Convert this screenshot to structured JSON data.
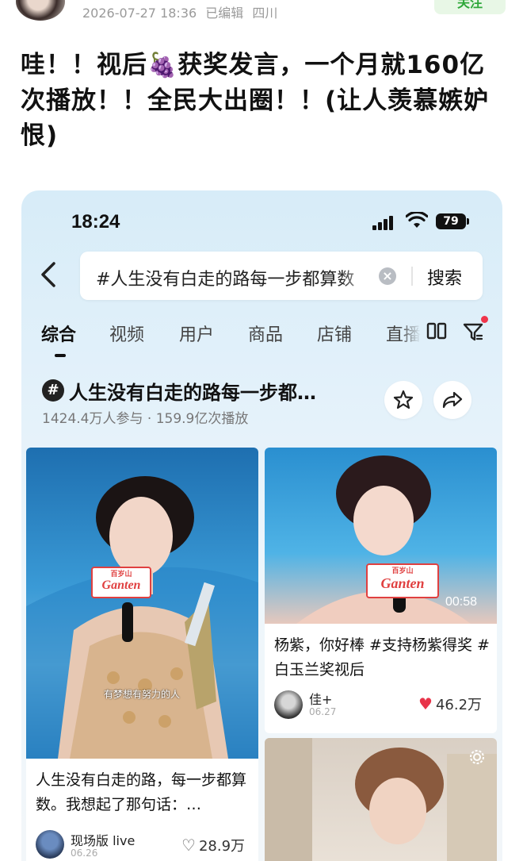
{
  "post": {
    "meta_date": "2026-07-27 18:36",
    "meta_edited": "已编辑",
    "meta_location": "四川",
    "follow_label": "关注",
    "title_part1": "哇！！视后",
    "title_emoji": "🍇",
    "title_part2": "获奖发言，一个月就160亿次播放！！全民大出圈！！(让人羡慕嫉妒恨)"
  },
  "screenshot": {
    "status_bar": {
      "time": "18:24",
      "battery": "79"
    },
    "search": {
      "query": "#人生没有白走的路每一步都算数",
      "clear_icon": "clear-icon",
      "button_label": "搜索"
    },
    "tabs": [
      {
        "label": "综合",
        "active": true
      },
      {
        "label": "视频"
      },
      {
        "label": "用户"
      },
      {
        "label": "商品"
      },
      {
        "label": "店铺"
      },
      {
        "label": "直播"
      }
    ],
    "topic": {
      "icon": "#",
      "title": "人生没有白走的路每一步都…",
      "participants": "1424.4万人参与",
      "separator": "·",
      "plays": "159.9亿次播放"
    },
    "cards": [
      {
        "mic_brand_top": "百岁山",
        "mic_brand": "Ganten",
        "subtitle": "有梦想有努力的人",
        "caption": "人生没有白走的路，每一步都算数。我想起了那句话：…",
        "user": "现场版 live",
        "date": "06.26",
        "likes": "28.9万",
        "liked": false
      },
      {
        "mic_brand_top": "百岁山",
        "mic_brand": "Ganten",
        "duration": "00:58",
        "caption": "杨紫，你好棒 #支持杨紫得奖 #白玉兰奖视后",
        "user": "佳+",
        "date": "06.27",
        "likes": "46.2万",
        "liked": true
      }
    ]
  },
  "colors": {
    "follow_text": "#2fa83a",
    "follow_bg": "#e8f7e6",
    "like_red": "#e8344a",
    "notification_dot": "#f0354b"
  }
}
